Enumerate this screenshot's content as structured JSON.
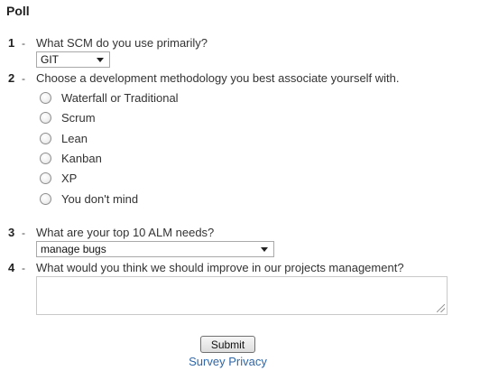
{
  "poll": {
    "title": "Poll",
    "dash": "-",
    "questions": [
      {
        "number": "1",
        "text": "What SCM do you use primarily?",
        "selected": "GIT"
      },
      {
        "number": "2",
        "text": "Choose a development methodology you best associate yourself with.",
        "options": [
          "Waterfall or Traditional",
          "Scrum",
          "Lean",
          "Kanban",
          "XP",
          "You don't mind"
        ]
      },
      {
        "number": "3",
        "text": "What are your top 10 ALM needs?",
        "selected": "manage bugs"
      },
      {
        "number": "4",
        "text": "What would you think we should improve in our projects management?",
        "value": ""
      }
    ],
    "submit_label": "Submit",
    "privacy_label": "Survey Privacy"
  }
}
